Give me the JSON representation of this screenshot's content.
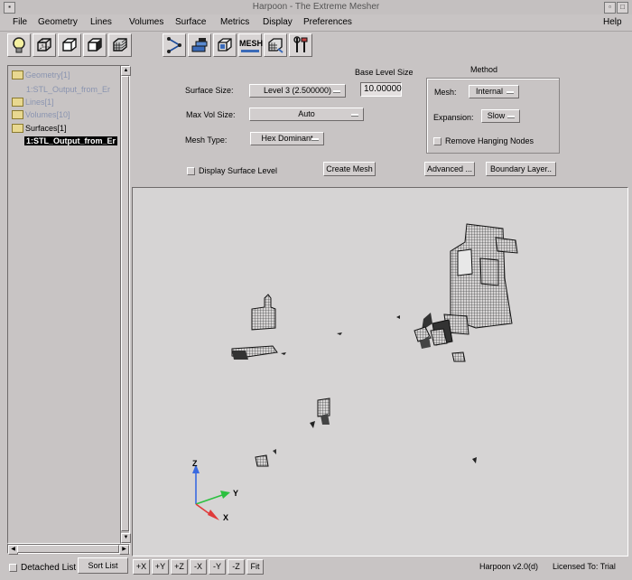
{
  "window": {
    "title": "Harpoon - The Extreme Mesher"
  },
  "menu": {
    "items": [
      "File",
      "Geometry",
      "Lines",
      "Volumes",
      "Surface",
      "Metrics",
      "Display",
      "Preferences"
    ],
    "help": "Help"
  },
  "toolbar": {
    "icons": [
      "bulb-icon",
      "cube-wireframe-icon",
      "cube-outline-icon",
      "cube-solid-icon",
      "cube-mesh-icon",
      "triangle-connect-icon",
      "layers-icon",
      "box-mesh-icon",
      "mesh-text-icon",
      "volume-mesh-icon",
      "tools-icon"
    ],
    "mesh_label": "MESH"
  },
  "tree": {
    "items": [
      {
        "label": "Geometry[1]",
        "folder": true
      },
      {
        "label": "1:STL_Output_from_Er",
        "folder": false
      },
      {
        "label": "Lines[1]",
        "folder": true
      },
      {
        "label": "Volumes[10]",
        "folder": true
      },
      {
        "label": "Surfaces[1]",
        "folder": true
      },
      {
        "label": "1:STL_Output_from_Er",
        "folder": false,
        "selected": true
      }
    ]
  },
  "controls": {
    "surface_size_label": "Surface  Size:",
    "surface_size_value": "Level 3 (2.500000)",
    "base_level_label": "Base Level Size",
    "base_level_value": "10.00000",
    "max_vol_label": "Max Vol  Size:",
    "max_vol_value": "Auto",
    "mesh_type_label": "Mesh Type:",
    "mesh_type_value": "Hex Dominant",
    "display_surface_label": "Display Surface Level",
    "create_mesh_label": "Create Mesh",
    "advanced_label": "Advanced ...",
    "boundary_layer_label": "Boundary Layer.."
  },
  "method": {
    "title": "Method",
    "mesh_label": "Mesh:",
    "mesh_value": "Internal",
    "expansion_label": "Expansion:",
    "expansion_value": "Slow",
    "remove_hanging_label": "Remove Hanging Nodes"
  },
  "axes": {
    "z": "Z",
    "y": "Y",
    "x": "X"
  },
  "bottom": {
    "detached_list": "Detached List",
    "sort_list": "Sort List",
    "view_buttons": [
      "+X",
      "+Y",
      "+Z",
      "-X",
      "-Y",
      "-Z",
      "Fit"
    ],
    "version": "Harpoon v2.0(d)",
    "license": "Licensed To: Trial"
  },
  "colors": {
    "background": "#c8c4c4",
    "viewport": "#d6d4d4",
    "selected": "#000000",
    "tree_text": "#8a94b0"
  }
}
